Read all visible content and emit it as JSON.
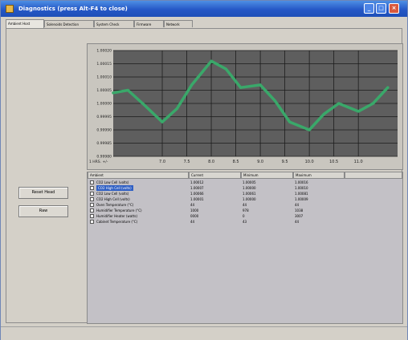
{
  "window": {
    "title": "Diagnostics (press Alt-F4 to close)"
  },
  "tabs": [
    {
      "label": "Ambient Host",
      "active": true
    },
    {
      "label": "Solenoids Detection"
    },
    {
      "label": "System Check"
    },
    {
      "label": "Firmware"
    },
    {
      "label": "Network"
    }
  ],
  "buttons": {
    "reset_label": "Reset Head",
    "raw_label": "Raw"
  },
  "chart_data": {
    "type": "line",
    "x": [
      6.0,
      6.3,
      6.6,
      7.0,
      7.3,
      7.6,
      8.0,
      8.3,
      8.6,
      9.0,
      9.3,
      9.6,
      10.0,
      10.3,
      10.6,
      11.0,
      11.3,
      11.6
    ],
    "series": [
      {
        "values": [
          1.00004,
          1.00005,
          1.0,
          0.99993,
          0.99998,
          1.00007,
          1.00016,
          1.00013,
          1.00006,
          1.00007,
          1.00001,
          0.99993,
          0.9999,
          0.99996,
          1.0,
          0.99997,
          1.0,
          1.00006
        ]
      }
    ],
    "ylim": [
      0.9998,
      1.0002
    ],
    "xlim": [
      6.0,
      11.8
    ],
    "yticks": [
      "1.00020",
      "1.00015",
      "1.00010",
      "1.00005",
      "1.00000",
      "0.99995",
      "0.99990",
      "0.99985",
      "0.99980"
    ],
    "xticks": [
      7.0,
      7.5,
      8.0,
      8.5,
      9.0,
      9.5,
      10.0,
      10.5,
      11.0
    ],
    "xtick_labels": [
      "7.0",
      "7.5",
      "8.0",
      "8.5",
      "9.0",
      "9.5",
      "10.0",
      "10.5",
      "11.0"
    ],
    "x_start_label": "1 HRS. +/-",
    "grid": true,
    "colors": {
      "background": "#5e5e5e",
      "line": "#3aa86a",
      "grid": "#1d1d1d"
    }
  },
  "table": {
    "columns": [
      "Ambient",
      "Current",
      "Minimum",
      "Maximum"
    ],
    "rows": [
      {
        "label": "CO2 Low Cell (volts)",
        "current": "1.00012",
        "min": "1.00005",
        "max": "1.00016",
        "selected": false
      },
      {
        "label": "CO2 High Cell (volts)",
        "current": "1.00007",
        "min": "1.00000",
        "max": "1.00010",
        "selected": true
      },
      {
        "label": "CO2 Low Cell (volts)",
        "current": "1.00066",
        "min": "1.00061",
        "max": "1.00081",
        "selected": false
      },
      {
        "label": "CO2 High Cell (volts)",
        "current": "1.00001",
        "min": "1.00000",
        "max": "1.00009",
        "selected": false
      },
      {
        "label": "Oven Temperature (°C)",
        "current": "44",
        "min": "44",
        "max": "44",
        "selected": false
      },
      {
        "label": "Humidifier Temperature (°C)",
        "current": "1000",
        "min": "978",
        "max": "1038",
        "selected": false
      },
      {
        "label": "Humidifier Heater (watts)",
        "current": "0000",
        "min": "0",
        "max": "3007",
        "selected": false
      },
      {
        "label": "Cabinet Temperature (°C)",
        "current": "44",
        "min": "43",
        "max": "44",
        "selected": false
      }
    ]
  }
}
